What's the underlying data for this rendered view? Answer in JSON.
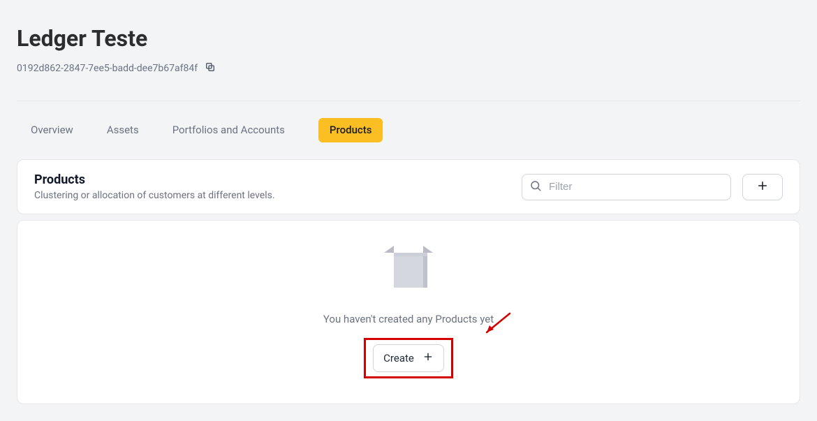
{
  "header": {
    "title": "Ledger Teste",
    "entity_id": "0192d862-2847-7ee5-badd-dee7b67af84f",
    "copy_icon_name": "copy-icon"
  },
  "tabs": [
    {
      "id": "overview",
      "label": "Overview",
      "active": false
    },
    {
      "id": "assets",
      "label": "Assets",
      "active": false
    },
    {
      "id": "portfolios",
      "label": "Portfolios and Accounts",
      "active": false
    },
    {
      "id": "products",
      "label": "Products",
      "active": true
    }
  ],
  "products_panel": {
    "title": "Products",
    "subtitle": "Clustering or allocation of customers at different levels.",
    "filter_placeholder": "Filter",
    "add_button_name": "add-product-button"
  },
  "empty_state": {
    "message": "You haven't created any Products yet",
    "create_label": "Create"
  },
  "annotation": {
    "highlight": "create-button",
    "arrow_color": "#d20000"
  },
  "colors": {
    "accent": "#fbbf24",
    "annotation": "#d20000",
    "text_muted": "#6b7280",
    "border": "#d1d5db",
    "panel_bg": "#ffffff",
    "page_bg": "#f3f4f6"
  }
}
